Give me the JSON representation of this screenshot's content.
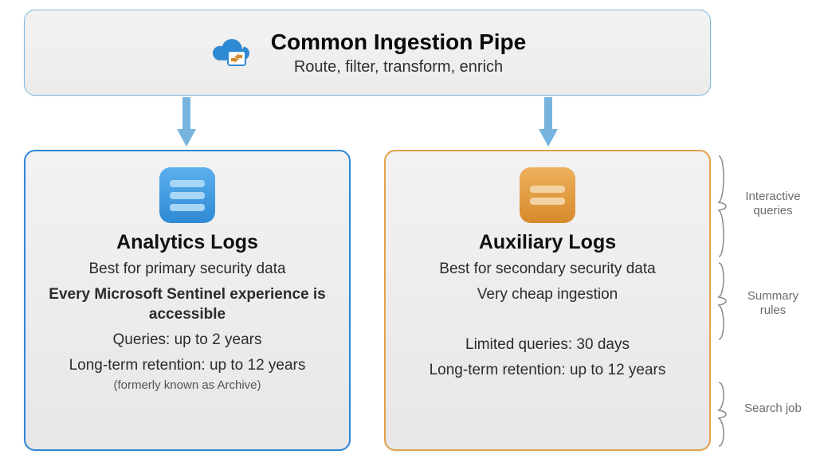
{
  "top": {
    "title": "Common Ingestion Pipe",
    "subtitle": "Route, filter, transform, enrich"
  },
  "left": {
    "title": "Analytics Logs",
    "line1": "Best for primary security data",
    "line2": "Every Microsoft Sentinel experience is accessible",
    "line3": "Queries: up to 2 years",
    "line4": "Long-term retention: up to 12 years",
    "line4_sub": "(formerly known as Archive)"
  },
  "right": {
    "title": "Auxiliary Logs",
    "line1": "Best for secondary security data",
    "line2": "Very cheap ingestion",
    "line3": "Limited queries: 30 days",
    "line4": "Long-term retention: up to 12 years"
  },
  "annotations": {
    "a1": "Interactive queries",
    "a2": "Summary rules",
    "a3": "Search job"
  }
}
